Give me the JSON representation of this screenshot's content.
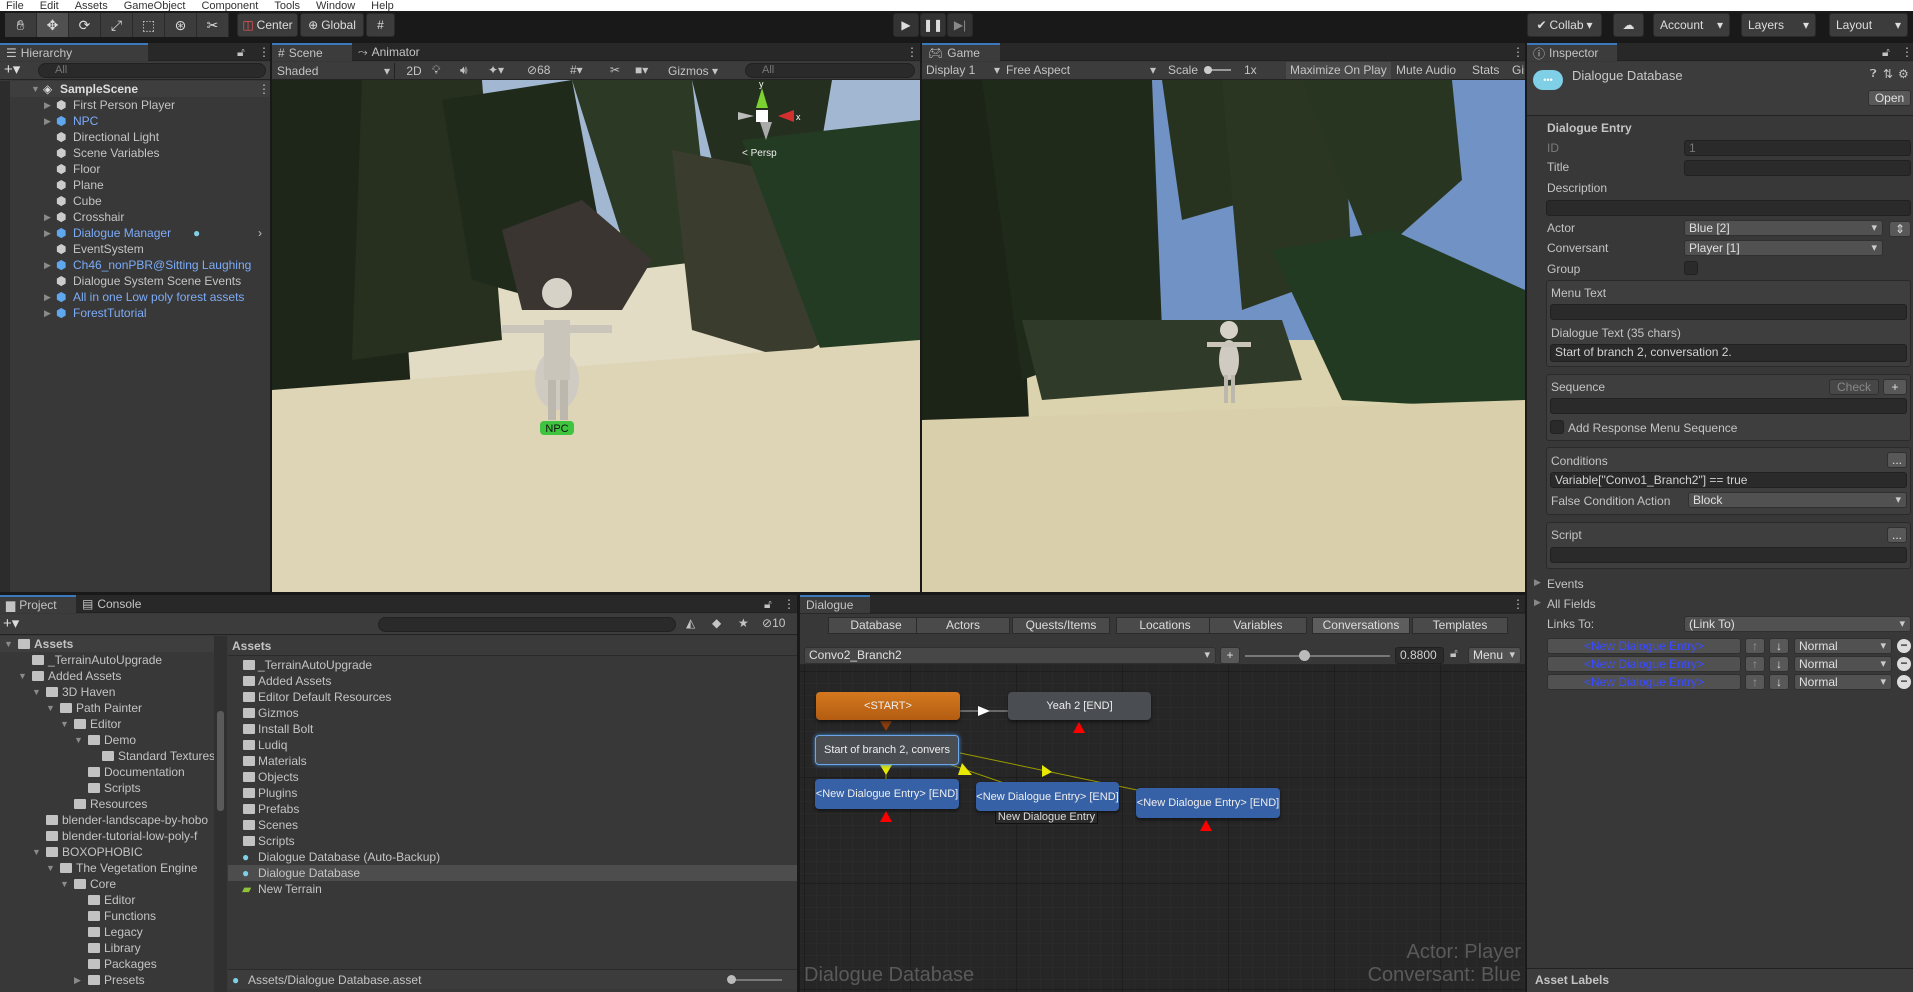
{
  "menu": [
    "File",
    "Edit",
    "Assets",
    "GameObject",
    "Component",
    "Tools",
    "Window",
    "Help"
  ],
  "toolbar": {
    "tools": [
      "hand-icon",
      "move-icon",
      "rotate-icon",
      "scale-icon",
      "rect-icon",
      "transform-icon",
      "custom-tool-icon"
    ],
    "pivot": "Center",
    "space": "Global",
    "collab": "Collab",
    "account": "Account",
    "layers": "Layers",
    "layout": "Layout"
  },
  "hierarchy": {
    "title": "Hierarchy",
    "search_placeholder": "All",
    "scene": "SampleScene",
    "items": [
      {
        "label": "First Person Player",
        "arrow": true,
        "prefab": false
      },
      {
        "label": "NPC",
        "arrow": true,
        "prefab": true
      },
      {
        "label": "Directional Light",
        "arrow": false,
        "prefab": false
      },
      {
        "label": "Scene Variables",
        "arrow": false,
        "prefab": false
      },
      {
        "label": "Floor",
        "arrow": false,
        "prefab": false
      },
      {
        "label": "Plane",
        "arrow": false,
        "prefab": false
      },
      {
        "label": "Cube",
        "arrow": false,
        "prefab": false
      },
      {
        "label": "Crosshair",
        "arrow": true,
        "prefab": false
      },
      {
        "label": "Dialogue Manager",
        "arrow": true,
        "prefab": true
      },
      {
        "label": "EventSystem",
        "arrow": false,
        "prefab": false
      },
      {
        "label": "Ch46_nonPBR@Sitting Laughing",
        "arrow": true,
        "prefab": true
      },
      {
        "label": "Dialogue System Scene Events",
        "arrow": false,
        "prefab": false
      },
      {
        "label": "All in one Low poly forest assets",
        "arrow": true,
        "prefab": true
      },
      {
        "label": "ForestTutorial",
        "arrow": true,
        "prefab": true
      }
    ]
  },
  "scene_view": {
    "tabs": [
      "Scene",
      "Animator"
    ],
    "shading": "Shaded",
    "mode_2d": "2D",
    "hidden_count": "68",
    "gizmos": "Gizmos",
    "search_placeholder": "All",
    "persp": "< Persp",
    "npc_label": "NPC",
    "axis_y": "y",
    "axis_x": "x"
  },
  "game_view": {
    "tab": "Game",
    "display": "Display 1",
    "aspect": "Free Aspect",
    "scale_label": "Scale",
    "scale_value": "1x",
    "maximize": "Maximize On Play",
    "mute": "Mute Audio",
    "stats": "Stats",
    "gizmos": "Gi"
  },
  "inspector": {
    "title": "Inspector",
    "asset_name": "Dialogue Database",
    "open": "Open",
    "section": "Dialogue Entry",
    "id_label": "ID",
    "id_value": "1",
    "title_label": "Title",
    "title_value": "",
    "description_label": "Description",
    "actor_label": "Actor",
    "actor_value": "Blue [2]",
    "conversant_label": "Conversant",
    "conversant_value": "Player [1]",
    "group_label": "Group",
    "menu_text_label": "Menu Text",
    "dialogue_text_label": "Dialogue Text (35 chars)",
    "dialogue_text_value": "Start of branch 2, conversation 2.",
    "sequence_label": "Sequence",
    "check": "Check",
    "plus": "+",
    "add_response": "Add Response Menu Sequence",
    "conditions_label": "Conditions",
    "conditions_value": "Variable[\"Convo1_Branch2\"] == true",
    "ellipsis": "...",
    "false_action_label": "False Condition Action",
    "false_action_value": "Block",
    "script_label": "Script",
    "events": "Events",
    "all_fields": "All Fields",
    "links_to_label": "Links To:",
    "links_to_value": "(Link To)",
    "links": [
      {
        "label": "<New Dialogue Entry>",
        "priority": "Normal"
      },
      {
        "label": "<New Dialogue Entry>",
        "priority": "Normal"
      },
      {
        "label": "<New Dialogue Entry>",
        "priority": "Normal"
      }
    ],
    "asset_labels": "Asset Labels"
  },
  "project": {
    "tabs": [
      "Project",
      "Console"
    ],
    "hidden_count": "10",
    "tree": [
      {
        "d": 0,
        "label": "Assets",
        "open": true
      },
      {
        "d": 1,
        "label": "_TerrainAutoUpgrade"
      },
      {
        "d": 1,
        "label": "Added Assets",
        "open": true
      },
      {
        "d": 2,
        "label": "3D Haven",
        "open": true
      },
      {
        "d": 3,
        "label": "Path Painter",
        "open": true
      },
      {
        "d": 4,
        "label": "Editor",
        "open": true
      },
      {
        "d": 5,
        "label": "Demo",
        "open": true
      },
      {
        "d": 6,
        "label": "Standard Textures"
      },
      {
        "d": 5,
        "label": "Documentation"
      },
      {
        "d": 5,
        "label": "Scripts"
      },
      {
        "d": 4,
        "label": "Resources"
      },
      {
        "d": 2,
        "label": "blender-landscape-by-hobo"
      },
      {
        "d": 2,
        "label": "blender-tutorial-low-poly-f"
      },
      {
        "d": 2,
        "label": "BOXOPHOBIC",
        "open": true
      },
      {
        "d": 3,
        "label": "The Vegetation Engine",
        "open": true
      },
      {
        "d": 4,
        "label": "Core",
        "open": true
      },
      {
        "d": 5,
        "label": "Editor"
      },
      {
        "d": 5,
        "label": "Functions"
      },
      {
        "d": 5,
        "label": "Legacy"
      },
      {
        "d": 5,
        "label": "Library"
      },
      {
        "d": 5,
        "label": "Packages"
      },
      {
        "d": 5,
        "label": "Presets",
        "closed": true
      }
    ],
    "list_header": "Assets",
    "list": [
      "_TerrainAutoUpgrade",
      "Added Assets",
      "Editor Default Resources",
      "Gizmos",
      "Install Bolt",
      "Ludiq",
      "Materials",
      "Objects",
      "Plugins",
      "Prefabs",
      "Scenes",
      "Scripts",
      "Dialogue Database (Auto-Backup)",
      "Dialogue Database",
      "New Terrain"
    ],
    "selected": "Dialogue Database",
    "status_path": "Assets/Dialogue Database.asset"
  },
  "dialogue": {
    "title": "Dialogue",
    "tabs": [
      "Database",
      "Actors",
      "Quests/Items",
      "Locations",
      "Variables",
      "Conversations",
      "Templates"
    ],
    "active_tab": "Conversations",
    "conversation": "Convo2_Branch2",
    "add": "+",
    "zoom": "0.8800",
    "menu": "Menu",
    "nodes": {
      "start": "<START>",
      "yeah": "Yeah 2 [END]",
      "branch": "Start of branch 2, convers",
      "entry1": "<New Dialogue Entry> [END]",
      "entry2": "<New Dialogue Entry> [END]",
      "entry3": "<New Dialogue Entry> [END]",
      "tooltip": "New Dialogue Entry"
    },
    "watermark": "Dialogue Database",
    "actor": "Actor: Player",
    "conversant": "Conversant: Blue",
    "colors": {
      "start": "#c8701e",
      "normal": "#4a4d52",
      "player": "#3761a6",
      "link": "#e8e800"
    }
  }
}
